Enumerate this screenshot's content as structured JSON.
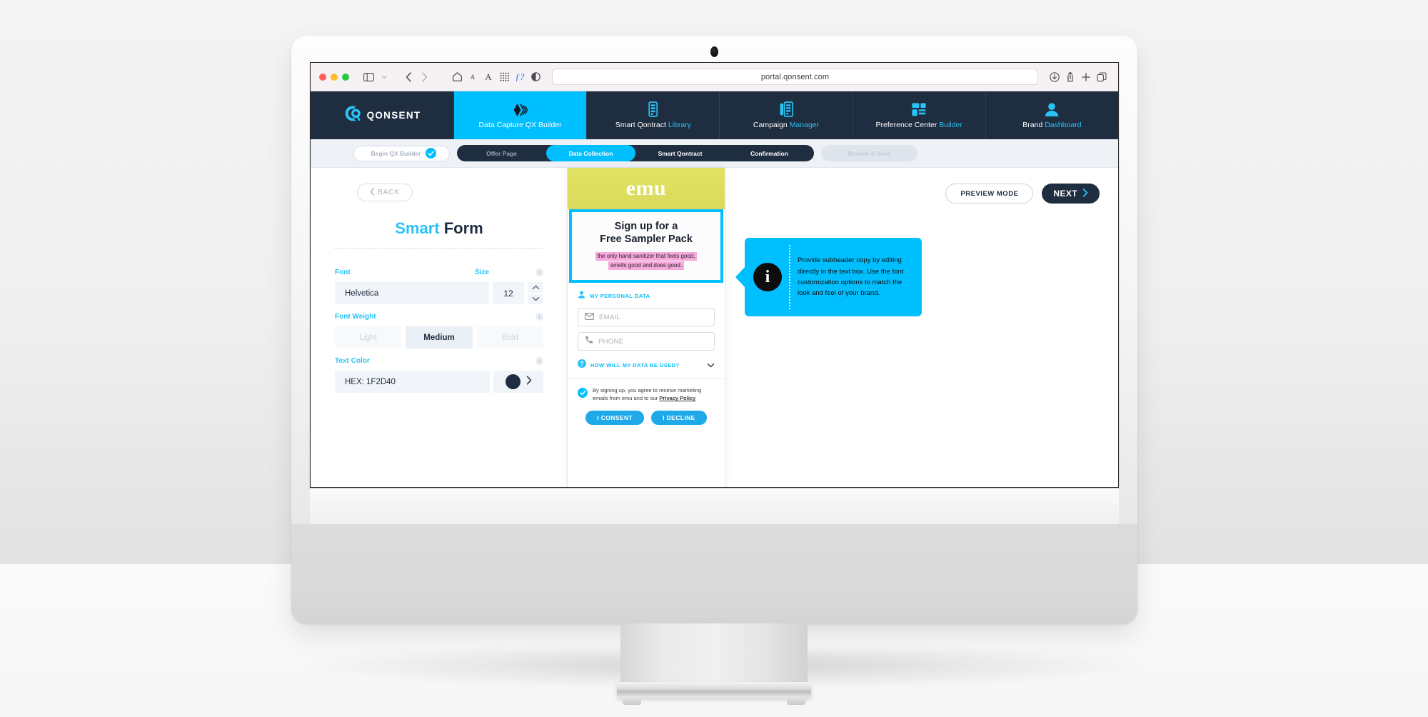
{
  "browser": {
    "url": "portal.qonsent.com",
    "icons": {
      "sidebar": "sidebar-toggle-icon",
      "sidebar_chevron": "chevron-down-icon",
      "back": "back-arrow-icon",
      "forward": "forward-arrow-icon",
      "home": "home-icon",
      "text_smaller": "text-size-small-icon",
      "text_larger": "text-size-large-icon",
      "grid": "grid-icon",
      "formula": "formula-icon",
      "reader": "reader-contrast-icon",
      "download": "download-icon",
      "share": "share-icon",
      "new_tab": "plus-icon",
      "tabs": "tab-overview-icon"
    }
  },
  "nav": {
    "logo_text": "QONSENT",
    "logo_icon": "qonsent-logo-icon",
    "items": [
      {
        "prefix": "Data Capture ",
        "accent": "QX Builder",
        "icon": "data-capture-icon",
        "active": true
      },
      {
        "prefix": "Smart Qontract ",
        "accent": "Library",
        "icon": "contract-library-icon",
        "active": false
      },
      {
        "prefix": "Campaign ",
        "accent": "Manager",
        "icon": "campaign-manager-icon",
        "active": false
      },
      {
        "prefix": "Preference Center ",
        "accent": "Builder",
        "icon": "preference-center-icon",
        "active": false
      },
      {
        "prefix": "Brand ",
        "accent": "Dashboard",
        "icon": "user-dashboard-icon",
        "active": false
      }
    ]
  },
  "stepper": {
    "begin_label": "Begin QX Builder",
    "begin_checked_icon": "check-icon",
    "steps": [
      {
        "label": "Offer Page",
        "state": "done"
      },
      {
        "label": "Data Collection",
        "state": "current"
      },
      {
        "label": "Smart Qontract",
        "state": "upcoming"
      },
      {
        "label": "Confirmation",
        "state": "upcoming"
      }
    ],
    "review_label": "Review & Save"
  },
  "actions": {
    "back_label": "BACK",
    "back_icon": "chevron-left-icon",
    "preview_label": "PREVIEW MODE",
    "next_label": "NEXT",
    "next_icon": "chevron-right-icon"
  },
  "panel": {
    "title_accent": "Smart",
    "title_rest": " Form",
    "font": {
      "label": "Font",
      "value": "Helvetica"
    },
    "size": {
      "label": "Size",
      "value": "12",
      "up_icon": "chevron-up-icon",
      "down_icon": "chevron-down-icon"
    },
    "font_weight": {
      "label": "Font Weight",
      "options": [
        {
          "label": "Light",
          "selected": false
        },
        {
          "label": "Medium",
          "selected": true
        },
        {
          "label": "Bold",
          "selected": false
        }
      ]
    },
    "text_color": {
      "label": "Text Color",
      "value": "HEX: 1F2D40",
      "swatch_hex": "#1F2D40",
      "expand_icon": "chevron-right-icon"
    },
    "info_icon": "info-icon"
  },
  "preview": {
    "brand": "emu",
    "brand_bg_hex": "#DEDE60",
    "headline_line1": "Sign up for a",
    "headline_line2": "Free Sampler Pack",
    "subheader_line1": "the only hand sanitizer that feels good,",
    "subheader_line2": "smells good and does good.",
    "subheader_highlight_hex": "#F7A8DD",
    "selection_outline_hex": "#00BFFF",
    "personal_data": {
      "section_label": "MY PERSONAL DATA",
      "section_icon": "person-icon",
      "fields": [
        {
          "placeholder": "EMAIL",
          "icon": "envelope-icon"
        },
        {
          "placeholder": "PHONE",
          "icon": "phone-icon"
        }
      ],
      "how_used_label": "HOW WILL MY DATA BE USED?",
      "how_used_icon": "question-circle-icon",
      "how_used_chevron": "chevron-down-icon"
    },
    "consent": {
      "check_icon": "check-circle-icon",
      "text_before": "By signing up, you agree to receive marketing emails from emu and to our ",
      "text_link": "Privacy Policy",
      "buttons": [
        {
          "label": "I CONSENT"
        },
        {
          "label": "I DECLINE"
        }
      ]
    }
  },
  "tooltip": {
    "icon": "info-icon",
    "text": "Provide subheader copy by editing directly in the text box. Use the font customization options to match the look and feel of your brand.",
    "bg_hex": "#00BFFF"
  }
}
